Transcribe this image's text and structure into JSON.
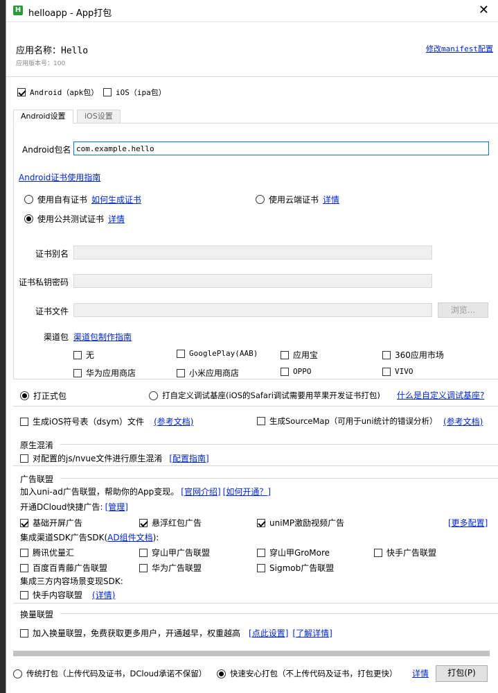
{
  "window": {
    "title": "helloapp - App打包",
    "icon_glyph": "H",
    "accent": "#2b9939"
  },
  "header": {
    "app_name": "应用名称：Hello",
    "app_version": "应用版本号：100",
    "edit_manifest": "修改manifest配置"
  },
  "platforms": {
    "android": "Android（apk包）",
    "android_checked": true,
    "ios": "iOS（ipa包）",
    "ios_checked": false
  },
  "tabs": {
    "android": "Android设置",
    "ios": "iOS设置",
    "active": "android"
  },
  "android": {
    "package_label": "Android包名",
    "package_value": "com.example.hello",
    "cert_guide": "Android证书使用指南",
    "cert_own": "使用自有证书",
    "cert_own_link": "如何生成证书",
    "cert_cloud": "使用云端证书",
    "cert_cloud_link": "详情",
    "cert_public": "使用公共测试证书",
    "cert_public_link": "详情",
    "selected_cert": "public",
    "alias_label": "证书别名",
    "password_label": "证书私钥密码",
    "file_label": "证书文件",
    "browse": "浏览...",
    "channel_label": "渠道包",
    "channel_guide": "渠道包制作指南",
    "channels": [
      {
        "label": "无",
        "checked": false
      },
      {
        "label": "GooglePlay(AAB)",
        "checked": false
      },
      {
        "label": "应用宝",
        "checked": false
      },
      {
        "label": "360应用市场",
        "checked": false
      },
      {
        "label": "华为应用商店",
        "checked": false
      },
      {
        "label": "小米应用商店",
        "checked": false
      },
      {
        "label": "OPPO",
        "checked": false
      },
      {
        "label": "VIVO",
        "checked": false
      }
    ]
  },
  "build_type": {
    "formal": "打正式包",
    "custom": "打自定义调试基座(iOS的Safari调试需要用苹果开发证书打包)",
    "custom_link": "什么是自定义调试基座?",
    "selected": "formal"
  },
  "dsym": {
    "label": "生成iOS符号表（dsym）文件",
    "link": "(参考文档)"
  },
  "sourcemap": {
    "label": "生成SourceMap（可用于uni统计的错误分析）",
    "link": "(参考文档)"
  },
  "obfuscation": {
    "section": "原生混淆",
    "label": "对配置的js/nvue文件进行原生混淆",
    "link": "[配置指南]"
  },
  "ads": {
    "section": "广告联盟",
    "intro": "加入uni-ad广告联盟，帮助你的App变现。",
    "intro_link1": "[官网介绍]",
    "intro_link2": "[如何开通？]",
    "dcloud_label": "开通DCloud快捷广告:",
    "dcloud_link": "[管理]",
    "quick": [
      {
        "label": "基础开屏广告",
        "checked": true
      },
      {
        "label": "悬浮红包广告",
        "checked": true
      },
      {
        "label": "uniMP激励视频广告",
        "checked": true
      }
    ],
    "more_config": "[更多配置]",
    "channel_sdk_label": "集成渠道SDK广告SDK(",
    "channel_sdk_link": "AD组件文档",
    "channel_sdk_suffix": "):",
    "sdks": [
      {
        "label": "腾讯优量汇",
        "checked": false
      },
      {
        "label": "穿山甲广告联盟",
        "checked": false
      },
      {
        "label": "穿山甲GroMore",
        "checked": false
      },
      {
        "label": "快手广告联盟",
        "checked": false
      },
      {
        "label": "百度百青藤广告联盟",
        "checked": false
      },
      {
        "label": "华为广告联盟",
        "checked": false
      },
      {
        "label": "Sigmob广告联盟",
        "checked": false
      }
    ],
    "third_label": "集成三方内容场景变现SDK:",
    "kuaishou_content": "快手内容联盟",
    "kuaishou_link": "(详情)"
  },
  "exchange": {
    "section": "换量联盟",
    "label": "加入换量联盟，免费获取更多用户，开通越早，权重越高",
    "link1": "[点此设置]",
    "link2": "[了解详情]"
  },
  "footer": {
    "traditional": "传统打包（上传代码及证书，DCloud承诺不保留）",
    "fast": "快速安心打包（不上传代码及证书，打包更快）",
    "selected": "fast",
    "details": "详情",
    "pack_button": "打包(P)"
  }
}
